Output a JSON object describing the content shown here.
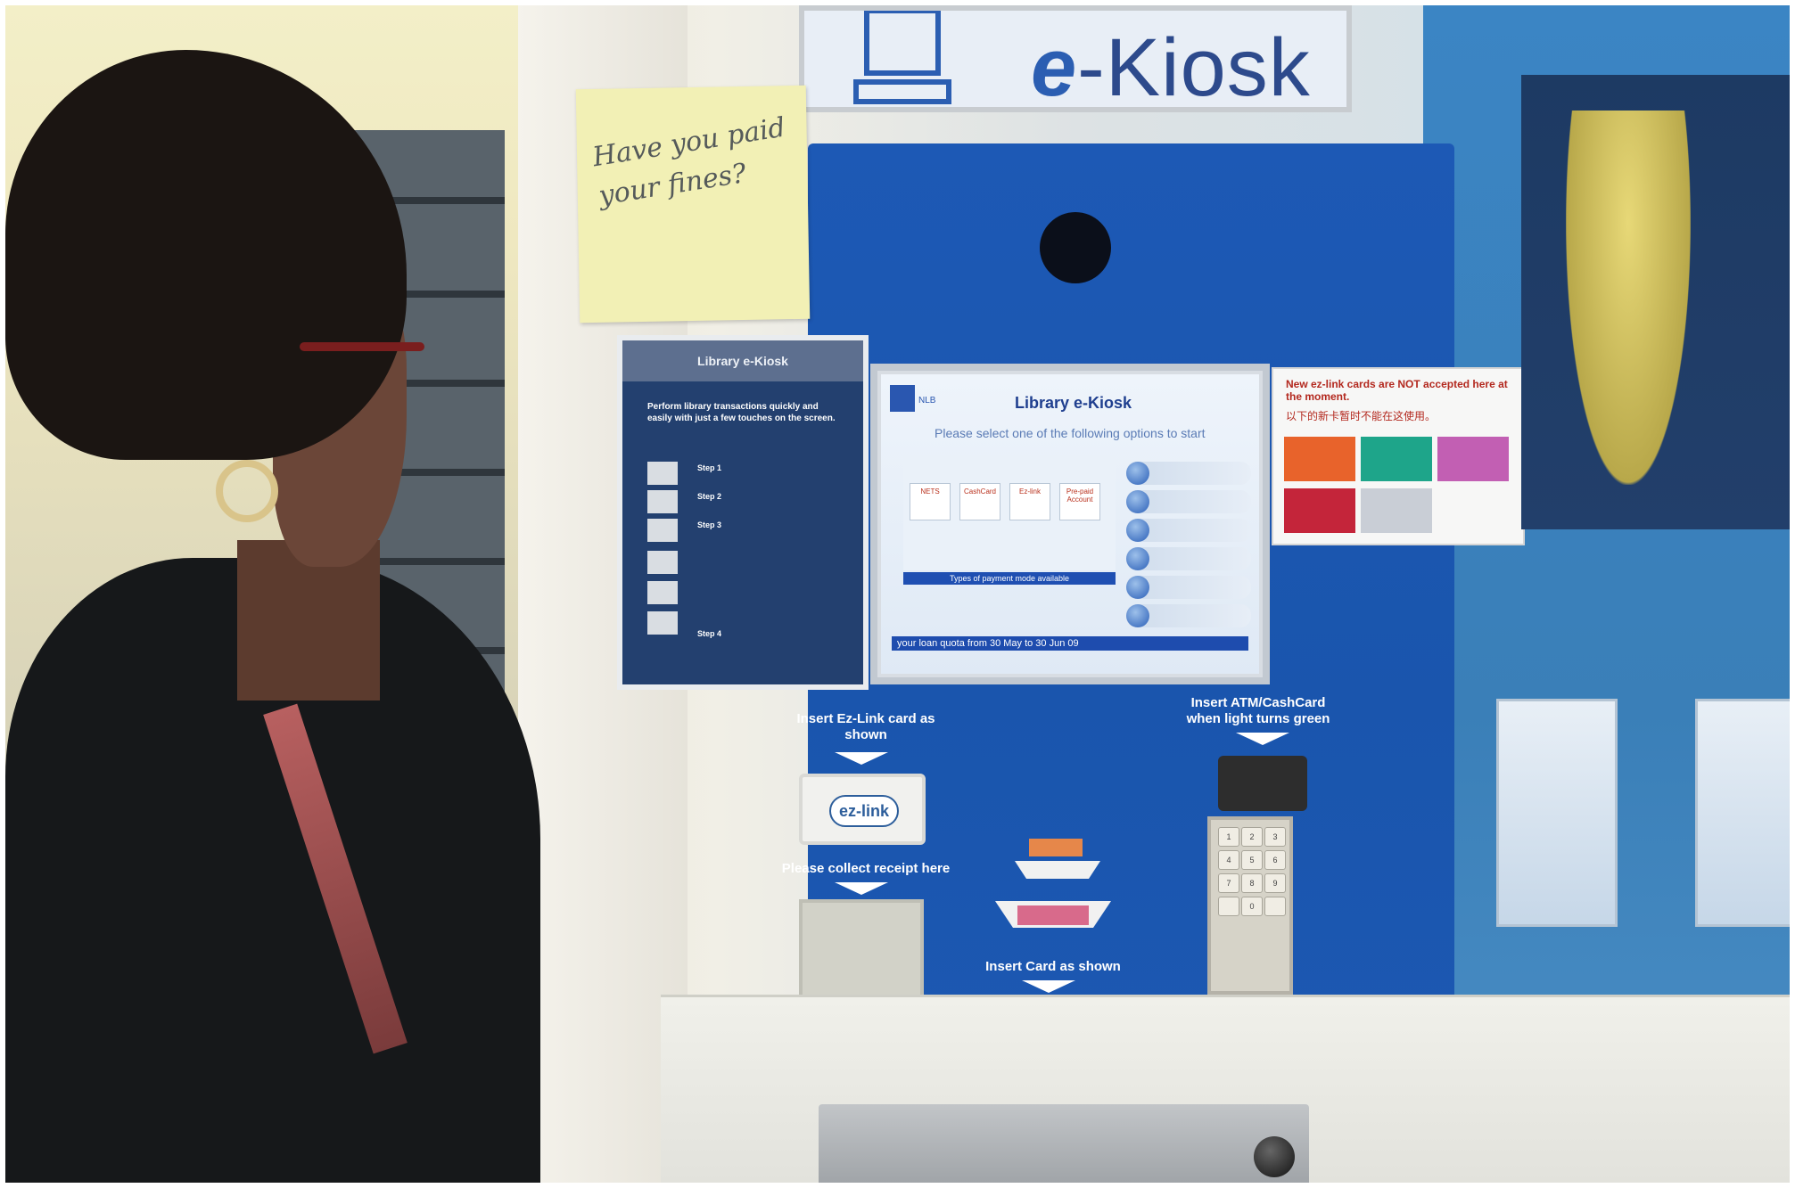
{
  "kiosk_sign": {
    "title_prefix": "e",
    "title_rest": "-Kiosk"
  },
  "sticky_note": {
    "text": "Have you paid your fines?"
  },
  "instructions_poster": {
    "title": "Library e-Kiosk",
    "intro": "Perform library transactions quickly and easily with just a few touches on the screen.",
    "steps": [
      "Step 1",
      "Step 2",
      "Step 3",
      "Step 4"
    ]
  },
  "screen": {
    "logo_text": "NLB",
    "title": "Library e-Kiosk",
    "prompt": "Please select one of the following options to start",
    "payment_cards": [
      "NETS",
      "CashCard",
      "Ez-link",
      "Pre-paid Account"
    ],
    "payment_caption": "Types of payment mode available",
    "footer": "your loan quota from 30 May to 30 Jun 09"
  },
  "notice": {
    "english": "New ez-link cards are NOT accepted here at the moment.",
    "chinese": "以下的新卡暂时不能在这使用。",
    "card_colors": [
      "#e8632b",
      "#1ea58a",
      "#c25fb3",
      "#c4253a"
    ]
  },
  "panel_labels": {
    "ezlink_insert": "Insert Ez-Link card as shown",
    "receipt": "Please collect receipt here",
    "atm_insert": "Insert ATM/CashCard when light turns green",
    "card_insert": "Insert Card as shown"
  },
  "ezlink_reader": {
    "logo": "ez-link"
  },
  "keypad_keys": [
    "1",
    "2",
    "3",
    "4",
    "5",
    "6",
    "7",
    "8",
    "9",
    "",
    "0",
    ""
  ],
  "colors": {
    "kiosk_blue": "#1b57b0",
    "wall_blue": "#3b82c0",
    "screen_blue": "#1e4cae"
  }
}
